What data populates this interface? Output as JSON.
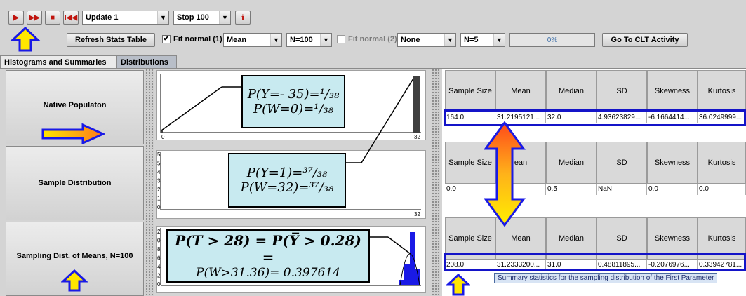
{
  "toolbar": {
    "update_value": "Update 1",
    "stop_value": "Stop 100",
    "refresh_label": "Refresh Stats Table",
    "fit1_label": "Fit normal (1)",
    "fit1_checked": "✔",
    "param1_value": "Mean",
    "n1_value": "N=100",
    "fit2_label": "Fit normal (2)",
    "param2_value": "None",
    "n2_value": "N=5",
    "progress_text": "0%",
    "progress": 0,
    "clt_label": "Go To CLT Activity",
    "info_label": "i"
  },
  "tabs": {
    "histograms": "Histograms and Summaries",
    "distributions": "Distributions"
  },
  "panels": {
    "native": "Native Populaton",
    "sample": "Sample Distribution",
    "sampling": "Sampling Dist. of Means, N=100"
  },
  "plots": {
    "native": {
      "x_min": "0",
      "x_max": "32"
    },
    "sample": {
      "x_max": "32",
      "y_ticks": [
        "5",
        "5",
        "4",
        "3",
        "2",
        "1",
        "0"
      ]
    },
    "sampling": {
      "x_max": "32",
      "y_ticks": [
        "2",
        "0",
        "8",
        "6",
        "4",
        "2",
        "0"
      ]
    }
  },
  "annotations": {
    "native_line1": "P(Y=- 35)=¹/₃₈",
    "native_line2": "P(W=0)=¹/₃₈",
    "sample_line1": "P(Y=1)=³⁷/₃₈",
    "sample_line2": "P(W=32)=³⁷/₃₈",
    "sampling_line1": "P(T > 28) = P(Y̅ > 0.28) =",
    "sampling_line2": "P(W>31.36)= 0.397614"
  },
  "tables": {
    "columns": [
      "Sample Size",
      "Mean",
      "Median",
      "SD",
      "Skewness",
      "Kurtosis"
    ],
    "native_row": [
      "164.0",
      "31.2195121...",
      "32.0",
      "4.93623829...",
      "-6.1664414...",
      "36.0249999..."
    ],
    "sample_columns": [
      "Sample Size",
      "ean",
      "Median",
      "SD",
      "Skewness",
      "Kurtosis"
    ],
    "sample_row": [
      "0.0",
      "",
      "0.5",
      "NaN",
      "0.0",
      "0.0"
    ],
    "sampling_row": [
      "208.0",
      "31.2333200...",
      "31.0",
      "0.48811895...",
      "-0.2076976...",
      "0.33942781..."
    ],
    "tooltip": "Summary statistics for the sampling distribution of the First Parameter"
  },
  "colors": {
    "highlight_border": "#1414c8",
    "callout_bg": "#c8eaf0",
    "arrow_orange": "#ff9a1a",
    "arrow_yellow": "#ffe600",
    "arrow_outline": "#1a1ae6"
  }
}
